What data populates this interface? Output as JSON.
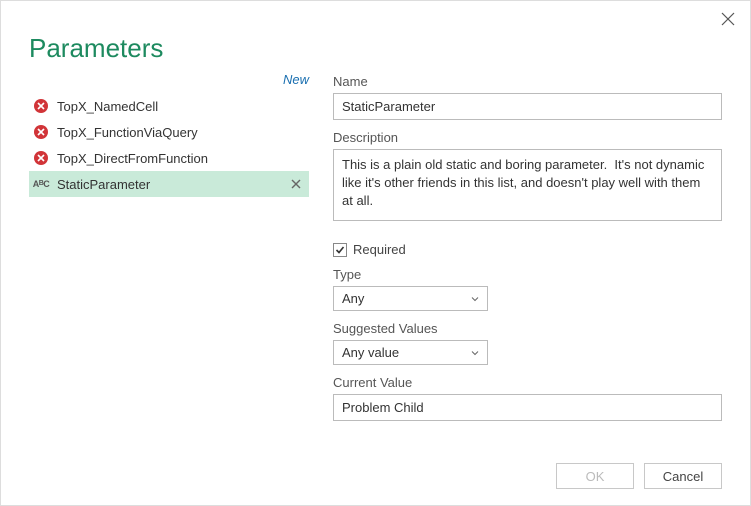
{
  "dialog": {
    "title": "Parameters",
    "new_link": "New"
  },
  "params": [
    {
      "label": "TopX_NamedCell",
      "error": true
    },
    {
      "label": "TopX_FunctionViaQuery",
      "error": true
    },
    {
      "label": "TopX_DirectFromFunction",
      "error": true
    },
    {
      "label": "StaticParameter",
      "error": false,
      "selected": true
    }
  ],
  "form": {
    "name_label": "Name",
    "name_value": "StaticParameter",
    "desc_label": "Description",
    "desc_value": "This is a plain old static and boring parameter.  It's not dynamic like it's other friends in this list, and doesn't play well with them at all.",
    "required_label": "Required",
    "required_checked": true,
    "type_label": "Type",
    "type_value": "Any",
    "suggested_label": "Suggested Values",
    "suggested_value": "Any value",
    "current_label": "Current Value",
    "current_value": "Problem Child"
  },
  "buttons": {
    "ok": "OK",
    "cancel": "Cancel"
  }
}
